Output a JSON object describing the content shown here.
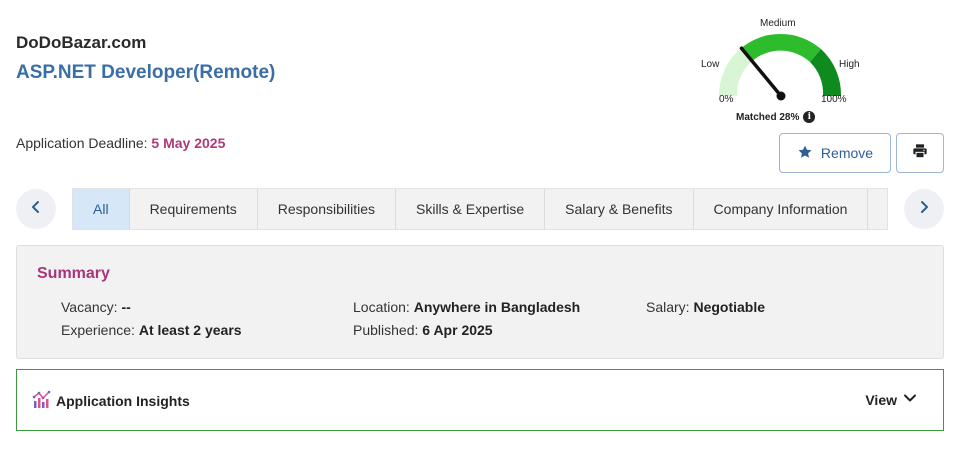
{
  "header": {
    "company": "DoDoBazar.com",
    "job_title": "ASP.NET Developer(Remote)",
    "deadline_label": "Application Deadline:",
    "deadline_date": "5 May 2025"
  },
  "match_gauge": {
    "label_low": "Low",
    "label_medium": "Medium",
    "label_high": "High",
    "min_label": "0%",
    "max_label": "100%",
    "matched_text": "Matched 28%",
    "matched_value": 28,
    "info_icon": "info-icon",
    "colors": {
      "low": "#d8f5d5",
      "medium": "#2cbc2c",
      "high": "#0f8a1e"
    }
  },
  "actions": {
    "remove_label": "Remove",
    "remove_icon": "star-icon",
    "print_icon": "printer-icon"
  },
  "tabs": [
    {
      "label": "All"
    },
    {
      "label": "Requirements"
    },
    {
      "label": "Responsibilities"
    },
    {
      "label": "Skills & Expertise"
    },
    {
      "label": "Salary & Benefits"
    },
    {
      "label": "Company Information"
    }
  ],
  "summary": {
    "title": "Summary",
    "vacancy_label": "Vacancy:",
    "vacancy_value": "--",
    "experience_label": "Experience:",
    "experience_value": "At least 2 years",
    "location_label": "Location:",
    "location_value": "Anywhere in Bangladesh",
    "published_label": "Published:",
    "published_value": "6 Apr 2025",
    "salary_label": "Salary:",
    "salary_value": "Negotiable"
  },
  "insights": {
    "title": "Application Insights",
    "view_label": "View",
    "icon": "insights-chart-icon"
  },
  "colors": {
    "accent_blue": "#3a6ea5",
    "accent_magenta": "#b03a78",
    "insights_border": "#3c9a3c"
  }
}
